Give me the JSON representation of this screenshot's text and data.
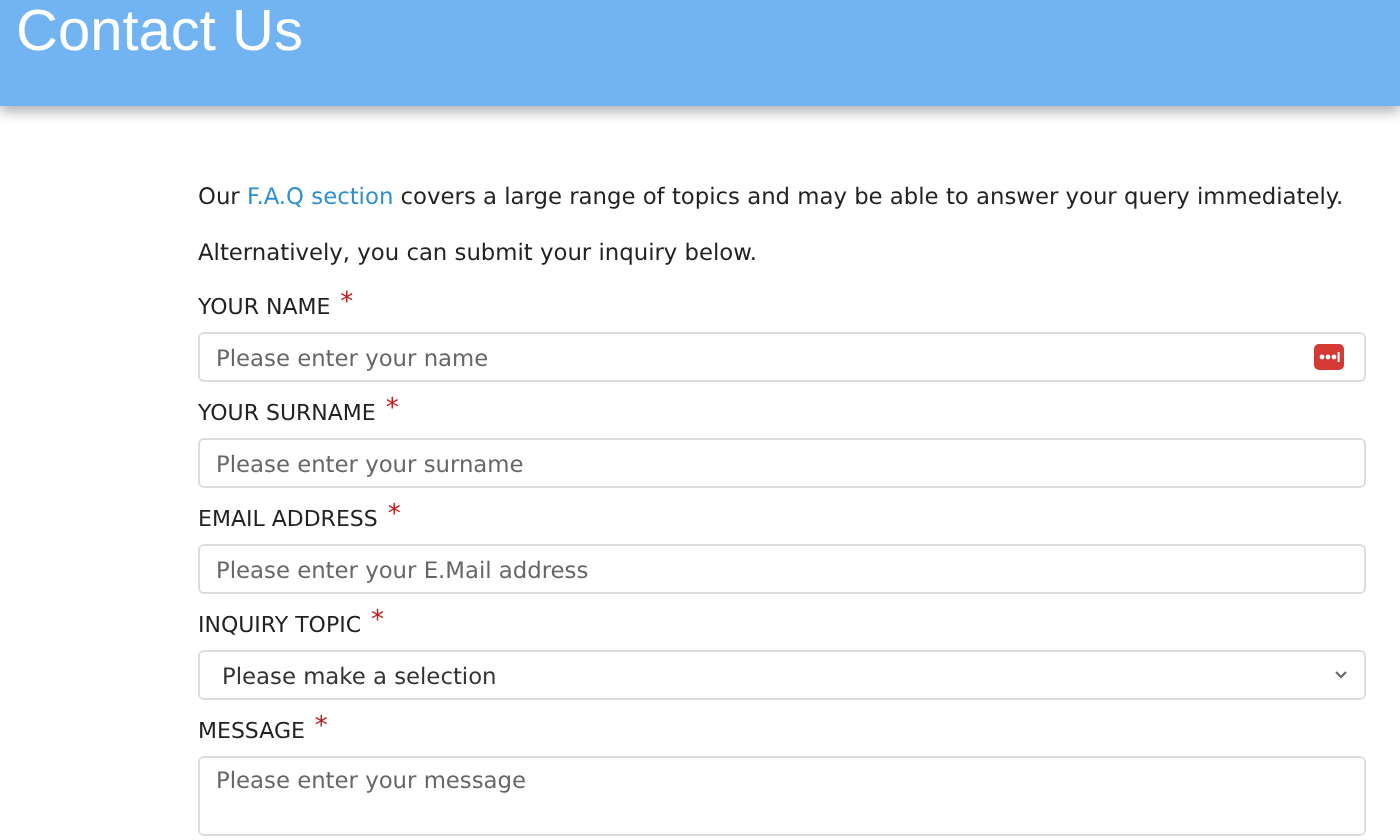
{
  "header": {
    "title": "Contact Us"
  },
  "intro": {
    "before": "Our ",
    "link": "F.A.Q section",
    "after": " covers a large range of topics and may be able to answer your query immediately."
  },
  "note": "Alternatively, you can submit your inquiry below.",
  "fields": [
    {
      "kind": "text",
      "label": "YOUR NAME",
      "required_mark": "*",
      "placeholder": "Please enter your name",
      "password_badge": true
    },
    {
      "kind": "text",
      "label": "YOUR SURNAME",
      "required_mark": "*",
      "placeholder": "Please enter your surname"
    },
    {
      "kind": "text",
      "label": "EMAIL ADDRESS",
      "required_mark": "*",
      "placeholder": "Please enter your E.Mail address"
    },
    {
      "kind": "select",
      "label": "INQUIRY TOPIC",
      "required_mark": "*",
      "value": "Please make a selection"
    },
    {
      "kind": "textarea",
      "label": "MESSAGE",
      "required_mark": "*",
      "placeholder": "Please enter your message"
    }
  ]
}
